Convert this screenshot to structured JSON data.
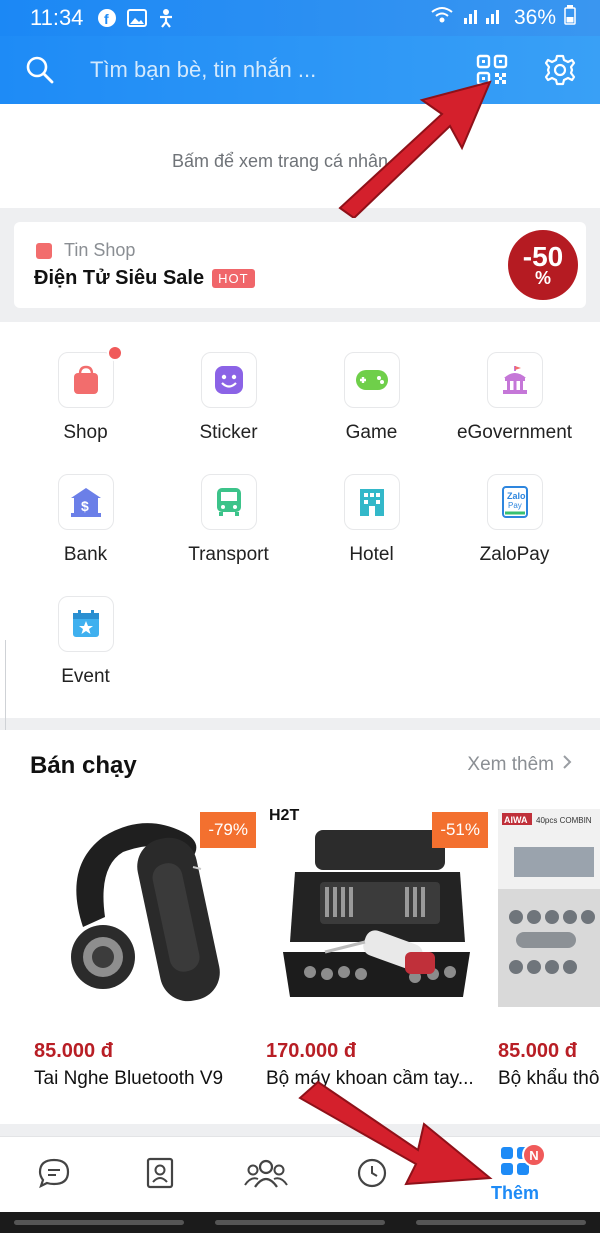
{
  "status_bar": {
    "time": "11:34",
    "battery": "36%"
  },
  "header": {
    "search_placeholder": "Tìm bạn bè, tin nhắn ..."
  },
  "profile": {
    "hint": "Bấm để xem trang cá nhân"
  },
  "banner": {
    "shop_label": "Tin Shop",
    "promo_text": "Điện Tử Siêu Sale",
    "hot_label": "HOT",
    "sale_big": "-50",
    "sale_pct": "%"
  },
  "apps": [
    {
      "label": "Shop",
      "icon": "shopping-bag-icon",
      "color": "#f26d6d",
      "has_dot": true
    },
    {
      "label": "Sticker",
      "icon": "smiley-icon",
      "color": "#8b63e6"
    },
    {
      "label": "Game",
      "icon": "gamepad-icon",
      "color": "#6fcf4a"
    },
    {
      "label": "eGovernment",
      "icon": "government-building-icon",
      "color": "#c577d8"
    },
    {
      "label": "Bank",
      "icon": "bank-icon",
      "color": "#6b7fe8"
    },
    {
      "label": "Transport",
      "icon": "bus-icon",
      "color": "#3cc38a"
    },
    {
      "label": "Hotel",
      "icon": "hotel-icon",
      "color": "#33b8c9"
    },
    {
      "label": "ZaloPay",
      "icon": "zalopay-icon",
      "color": "#2e86de"
    },
    {
      "label": "Event",
      "icon": "calendar-star-icon",
      "color": "#3fb0ef"
    }
  ],
  "bestsellers": {
    "title": "Bán chạy",
    "more_label": "Xem thêm",
    "products": [
      {
        "discount": "-79%",
        "price": "85.000 đ",
        "name": "Tai Nghe Bluetooth V9"
      },
      {
        "discount": "-51%",
        "price": "170.000 đ",
        "name": "Bộ máy khoan cầm tay...",
        "brand": "H2T"
      },
      {
        "price": "85.000 đ",
        "name": "Bộ khẩu thôn",
        "brand": "AIWA",
        "box_text": "40pcs COMBIN"
      }
    ]
  },
  "bottom_nav": {
    "active_label": "Thêm",
    "badge": "N",
    "items": [
      "chat-icon",
      "contacts-icon",
      "group-icon",
      "timeline-icon",
      "more-icon"
    ]
  },
  "colors": {
    "brand_blue": "#1e8bf6",
    "price_red": "#b81e25",
    "discount_orange": "#f3702f"
  }
}
